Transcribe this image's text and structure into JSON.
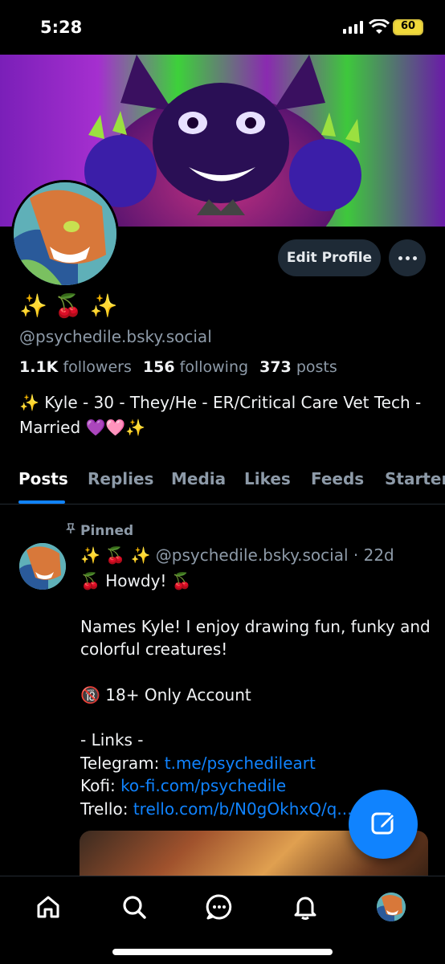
{
  "status_bar": {
    "time": "5:28",
    "battery": "60"
  },
  "profile": {
    "display_name": "✨ 🍒 ✨",
    "handle": "@psychedile.bsky.social",
    "followers_count": "1.1K",
    "followers_label": "followers",
    "following_count": "156",
    "following_label": "following",
    "posts_count": "373",
    "posts_label": "posts",
    "bio": "✨ Kyle - 30 - They/He - ER/Critical Care Vet Tech - Married 💜🩷✨",
    "edit_button": "Edit Profile"
  },
  "tabs": [
    "Posts",
    "Replies",
    "Media",
    "Likes",
    "Feeds",
    "Starter"
  ],
  "active_tab": "Posts",
  "pinned_post": {
    "pinned_label": "Pinned",
    "author_name": "✨ 🍒 ✨",
    "author_handle": "@psychedile.bsky.social",
    "time": "· 22d",
    "line1": "🍒 Howdy! 🍒",
    "line2": "Names Kyle! I enjoy drawing fun, funky and colorful creatures!",
    "line3": "🔞 18+ Only Account",
    "line4": "- Links -",
    "telegram_label": "Telegram:",
    "telegram_link": "t.me/psychedileart",
    "kofi_label": "Kofi:",
    "kofi_link": "ko-fi.com/psychedile",
    "trello_label": "Trello:",
    "trello_link": "trello.com/b/N0gOkhxQ/q..."
  },
  "colors": {
    "accent": "#1083fe",
    "button_bg": "#1e2a36",
    "muted_text": "#8d9aa8"
  },
  "nav": [
    "home-icon",
    "search-icon",
    "chat-icon",
    "bell-icon",
    "profile-avatar"
  ]
}
